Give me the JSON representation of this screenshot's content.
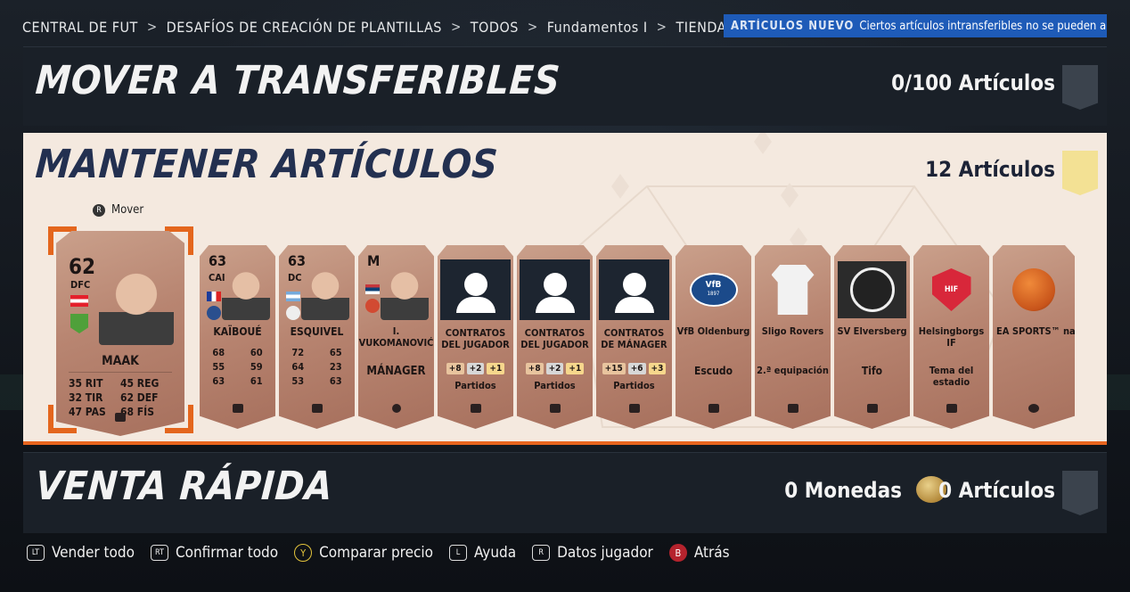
{
  "breadcrumb": {
    "items": [
      "CENTRAL DE FUT",
      "DESAFÍOS DE CREACIÓN DE PLANTILLAS",
      "TODOS",
      "Fundamentos I",
      "TIENDA",
      "ARTÍCULOS NUEVO"
    ],
    "separator": ">"
  },
  "toast": {
    "ghost": "ARTÍCULOS NUEVO",
    "text": "Ciertos artículos intransferibles no se pueden añadir a la Lista de transferibles."
  },
  "transfer_panel": {
    "title": "MOVER A TRANSFERIBLES",
    "count": "0/100 Artículos",
    "badge_color": "#3b434d"
  },
  "keep_panel": {
    "title": "MANTENER ARTÍCULOS",
    "count": "12 Artículos",
    "badge_color": "#f3e194",
    "move_hint": "Mover",
    "move_key": "R"
  },
  "cards": {
    "featured": {
      "rating": "62",
      "position": "DFC",
      "name": "MAAK",
      "stats": [
        {
          "v": "35",
          "k": "RIT"
        },
        {
          "v": "45",
          "k": "REG"
        },
        {
          "v": "32",
          "k": "TIR"
        },
        {
          "v": "62",
          "k": "DEF"
        },
        {
          "v": "47",
          "k": "PAS"
        },
        {
          "v": "68",
          "k": "FÍS"
        }
      ]
    },
    "player2": {
      "rating": "63",
      "position": "CAI",
      "name": "KAÏBOUÉ",
      "stats": [
        "68",
        "60",
        "55",
        "59",
        "63",
        "61"
      ]
    },
    "player3": {
      "rating": "63",
      "position": "DC",
      "name": "ESQUIVEL",
      "stats": [
        "72",
        "65",
        "64",
        "23",
        "53",
        "63"
      ]
    },
    "manager": {
      "rating": "M",
      "name": "I. VUKOMANOVIĆ",
      "label": "MÁNAGER"
    },
    "contract1": {
      "line1": "CONTRATOS",
      "line2": "DEL JUGADOR",
      "boosts": [
        "+8",
        "+2",
        "+1"
      ],
      "label": "Partidos"
    },
    "contract2": {
      "line1": "CONTRATOS",
      "line2": "DEL JUGADOR",
      "boosts": [
        "+8",
        "+2",
        "+1"
      ],
      "label": "Partidos"
    },
    "contract3": {
      "line1": "CONTRATOS",
      "line2": "DE MÁNAGER",
      "boosts": [
        "+15",
        "+6",
        "+3"
      ],
      "label": "Partidos"
    },
    "badge": {
      "name": "VfB Oldenburg",
      "label": "Escudo",
      "logo": "VfB",
      "logo_year": "1897"
    },
    "kit": {
      "name": "Sligo Rovers",
      "label": "2.ª equipación"
    },
    "tifo": {
      "name": "SV Elversberg",
      "label": "Tifo"
    },
    "stadium": {
      "name": "Helsingborgs IF",
      "label": "Tema del estadio",
      "logo": "HIF"
    },
    "ball": {
      "name": "EA SPORTS™ naranja"
    }
  },
  "quick_sell": {
    "title": "VENTA RÁPIDA",
    "coins": "0 Monedas",
    "count": "0 Artículos",
    "badge_color": "#3b434d"
  },
  "hints": [
    {
      "key": "LT",
      "label": "Vender todo"
    },
    {
      "key": "RT",
      "label": "Confirmar todo"
    },
    {
      "key": "Y",
      "label": "Comparar precio"
    },
    {
      "key": "L",
      "label": "Ayuda"
    },
    {
      "key": "R",
      "label": "Datos jugador"
    },
    {
      "key": "B",
      "label": "Atrás"
    }
  ],
  "colors": {
    "accent": "#e8651e",
    "toast": "#1e5bb8",
    "card_bronze": "#b88571"
  }
}
